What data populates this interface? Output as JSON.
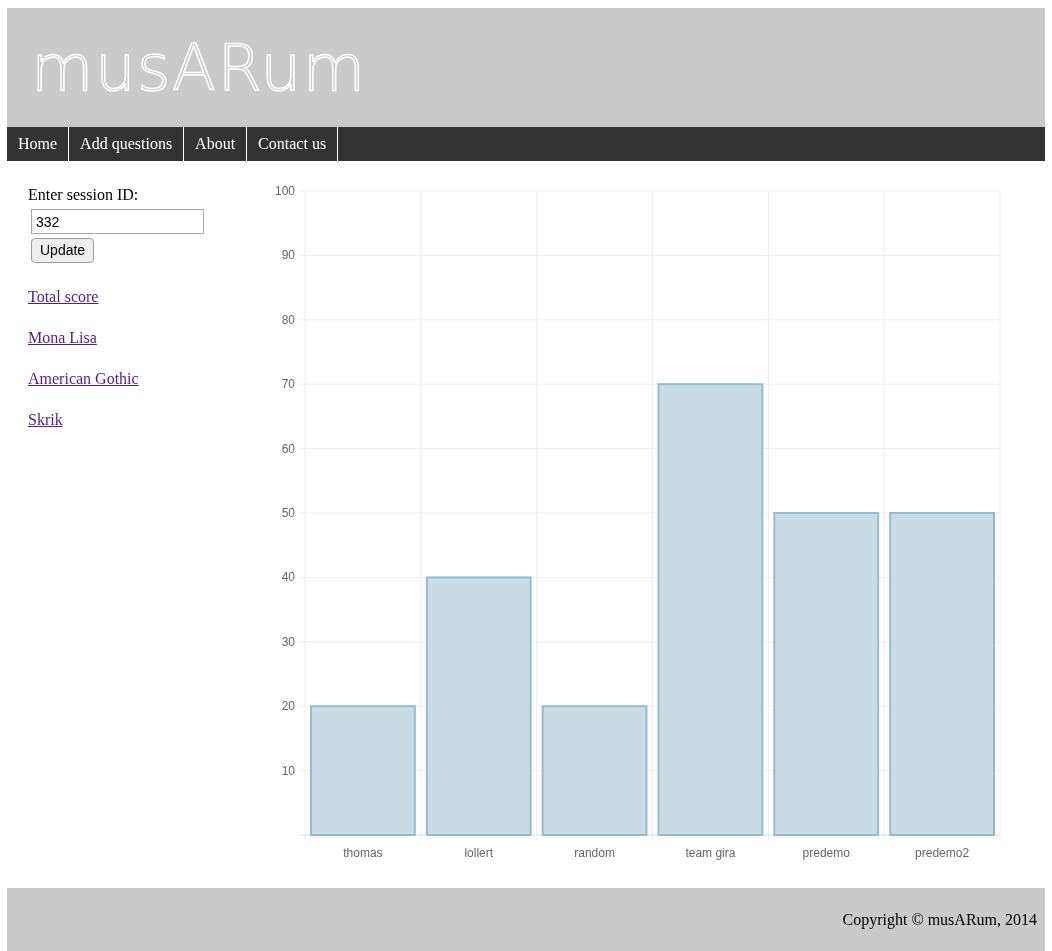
{
  "header": {
    "logo": "musARum"
  },
  "nav": [
    {
      "label": "Home"
    },
    {
      "label": "Add questions"
    },
    {
      "label": "About"
    },
    {
      "label": "Contact us"
    }
  ],
  "sidebar": {
    "label": "Enter session ID:",
    "session_id": "332",
    "button": "Update",
    "links": [
      "Total score",
      "Mona Lisa",
      "American Gothic",
      "Skrik"
    ]
  },
  "chart": {
    "chart_data": {
      "type": "bar",
      "categories": [
        "thomas",
        "lollert",
        "random",
        "team gira",
        "predemo",
        "predemo2"
      ],
      "series": [
        {
          "color": "#c9dce6",
          "values": [
            20,
            40,
            20,
            70,
            50,
            50
          ]
        }
      ],
      "grid": true,
      "ylim": [
        0,
        100
      ],
      "yticks": [
        10,
        20,
        30,
        40,
        50,
        60,
        70,
        80,
        90,
        100
      ]
    }
  },
  "footer": {
    "copyright": "Copyright © musARum, 2014"
  }
}
